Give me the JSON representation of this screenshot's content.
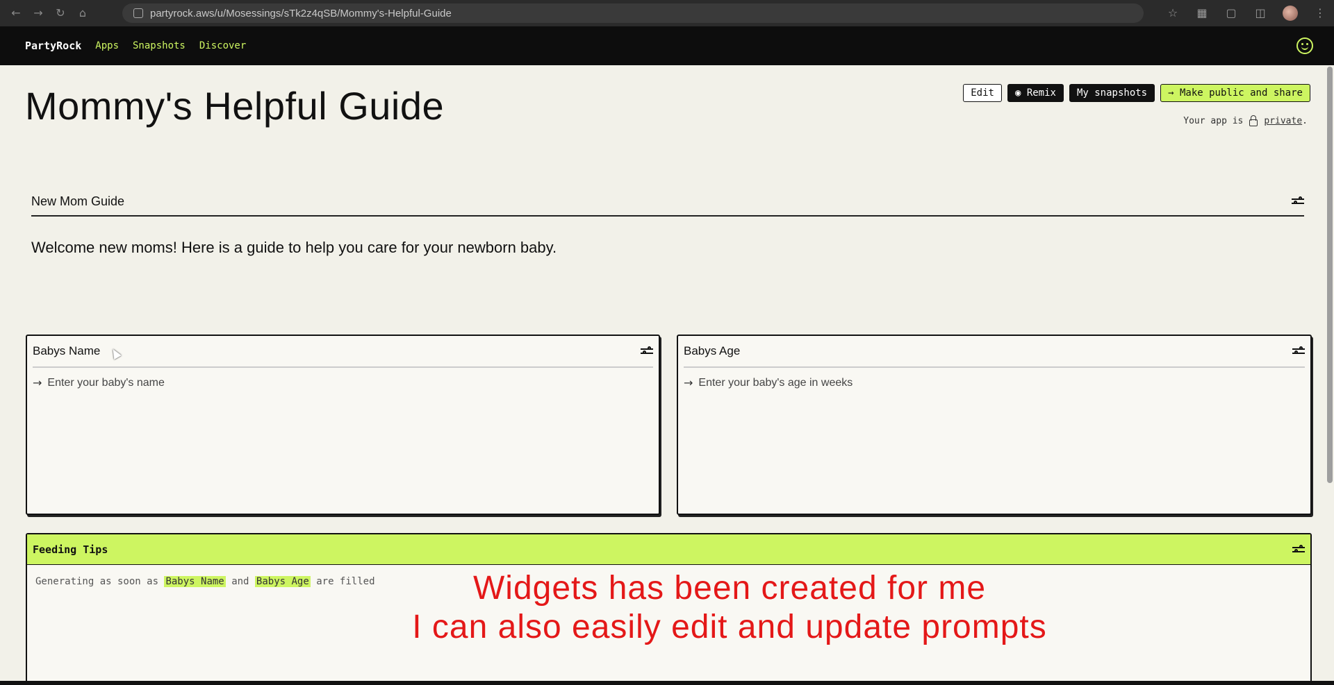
{
  "browser": {
    "url": "partyrock.aws/u/Mosessings/sTk2z4qSB/Mommy's-Helpful-Guide"
  },
  "nav": {
    "brand": "PartyRock",
    "links": [
      "Apps",
      "Snapshots",
      "Discover"
    ]
  },
  "header": {
    "title": "Mommy's Helpful Guide",
    "buttons": {
      "edit": "Edit",
      "remix": "Remix",
      "snapshots": "My snapshots",
      "share": "Make public and share"
    },
    "privacy_prefix": "Your app is",
    "privacy_link": "private",
    "privacy_suffix": "."
  },
  "widgets": {
    "static": {
      "title": "New Mom Guide",
      "text": "Welcome new moms! Here is a guide to help you care for your newborn baby."
    },
    "baby_name": {
      "title": "Babys Name",
      "placeholder": "Enter your baby's name"
    },
    "baby_age": {
      "title": "Babys Age",
      "placeholder": "Enter your baby's age in weeks"
    },
    "feeding": {
      "title": "Feeding Tips",
      "text_prefix": "Generating as soon as",
      "ref1": "Babys Name",
      "text_and": "and",
      "ref2": "Babys Age",
      "text_suffix": "are filled"
    }
  },
  "caption": {
    "line1": "Widgets has been created for me",
    "line2": "I can also easily edit and update prompts"
  },
  "colors": {
    "accent": "#cdf561",
    "caption": "#e41818"
  }
}
